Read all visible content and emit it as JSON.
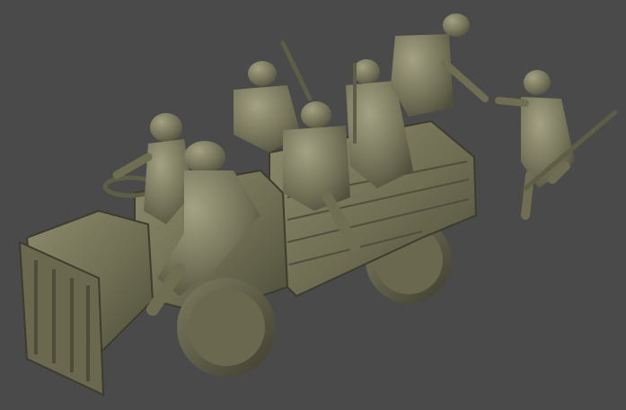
{
  "scene": {
    "subject": "3d-render-military-vehicle-with-soldiers",
    "background_color": "#4a4a4a",
    "model_color": "#7a7a5e",
    "model_shadow_color": "#4e4d3a",
    "model_highlight_color": "#9c9b7c"
  }
}
